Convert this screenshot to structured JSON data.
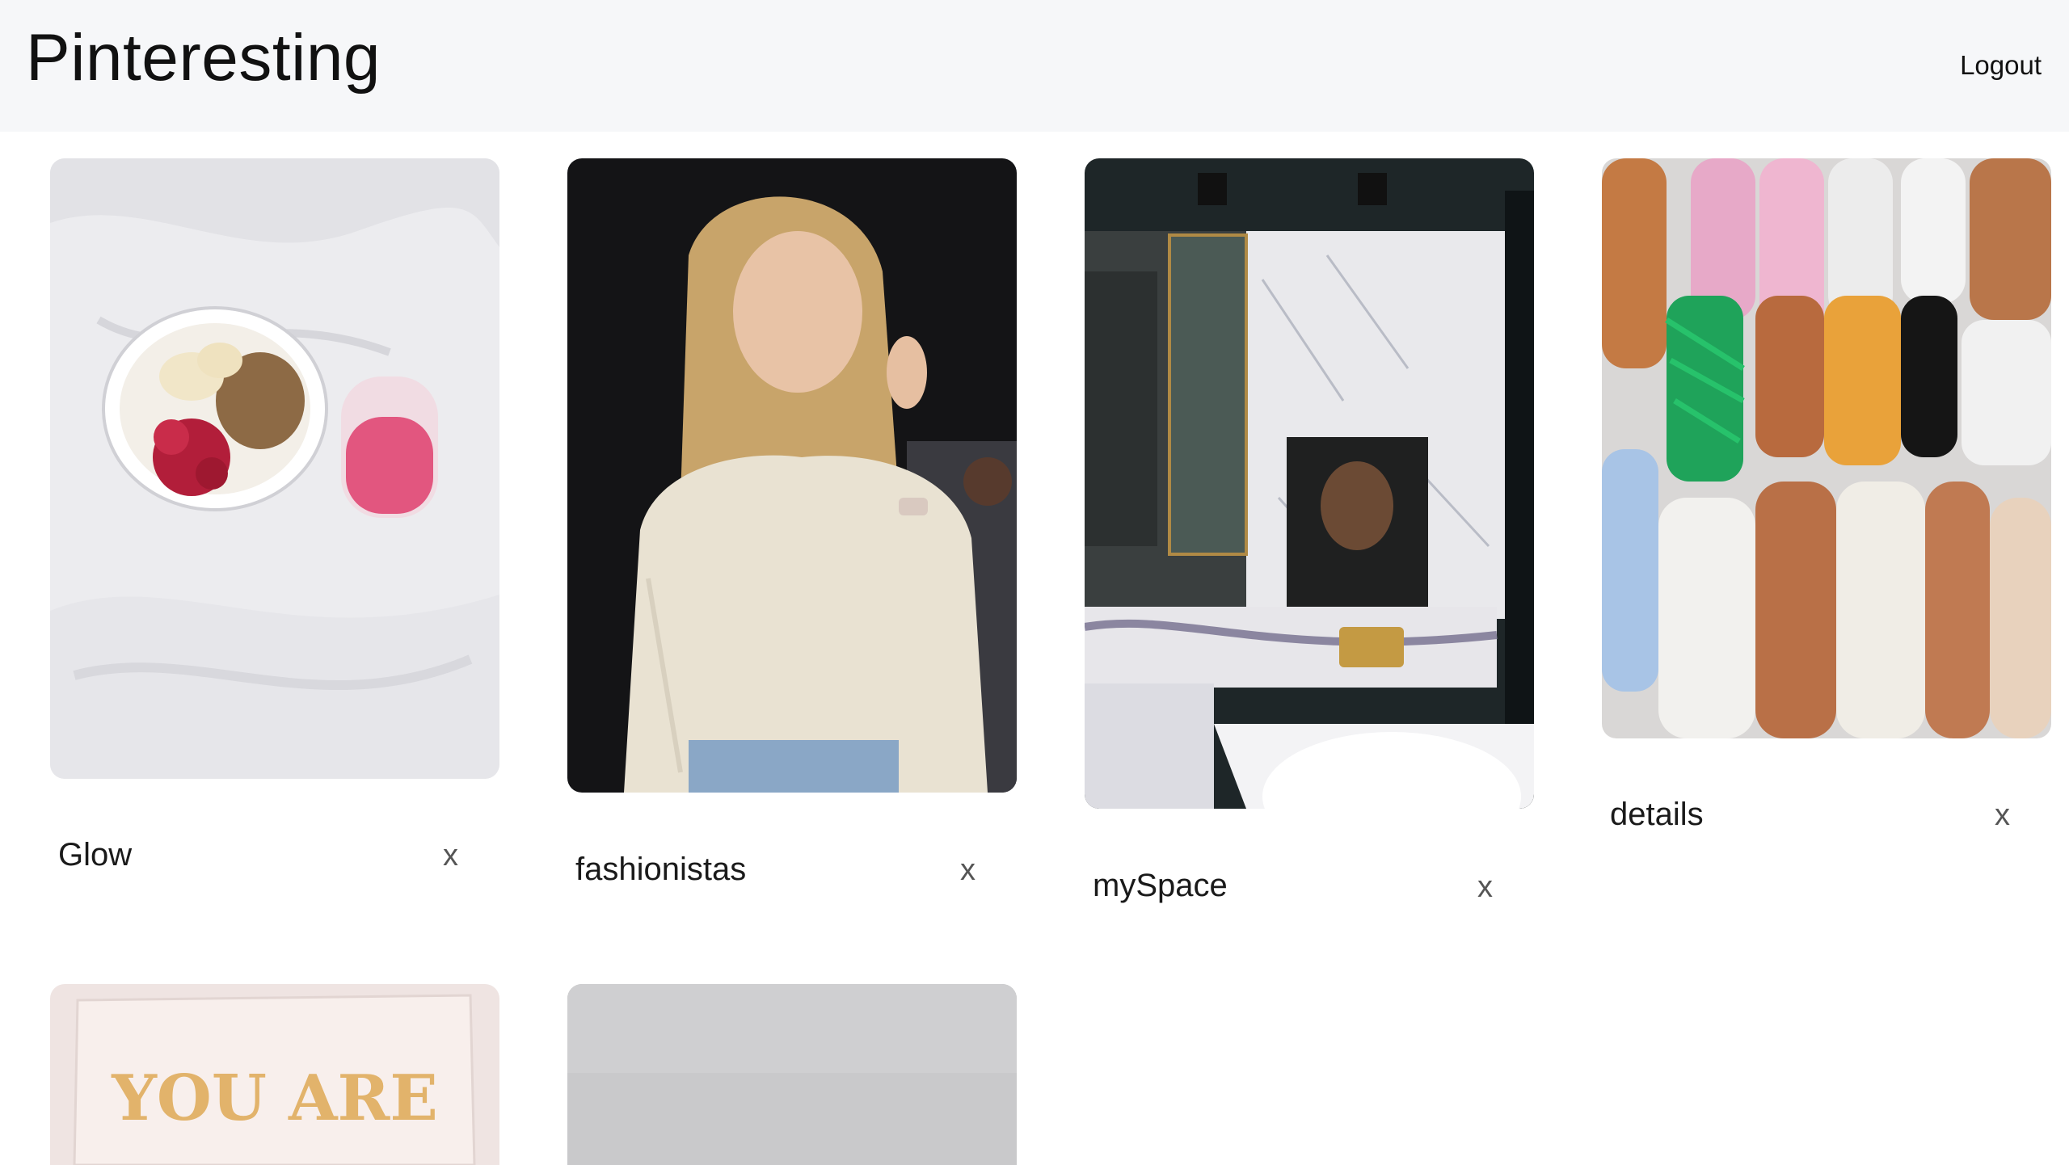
{
  "app": {
    "title": "Pinteresting"
  },
  "nav": {
    "logout_label": "Logout"
  },
  "boards": [
    {
      "name": "Glow",
      "remove_label": "x"
    },
    {
      "name": "fashionistas",
      "remove_label": "x"
    },
    {
      "name": "mySpace",
      "remove_label": "x"
    },
    {
      "name": "details",
      "remove_label": "x"
    }
  ],
  "partial_boards": [
    {
      "image_text": "YOU ARE"
    },
    {
      "image_text": ""
    }
  ]
}
